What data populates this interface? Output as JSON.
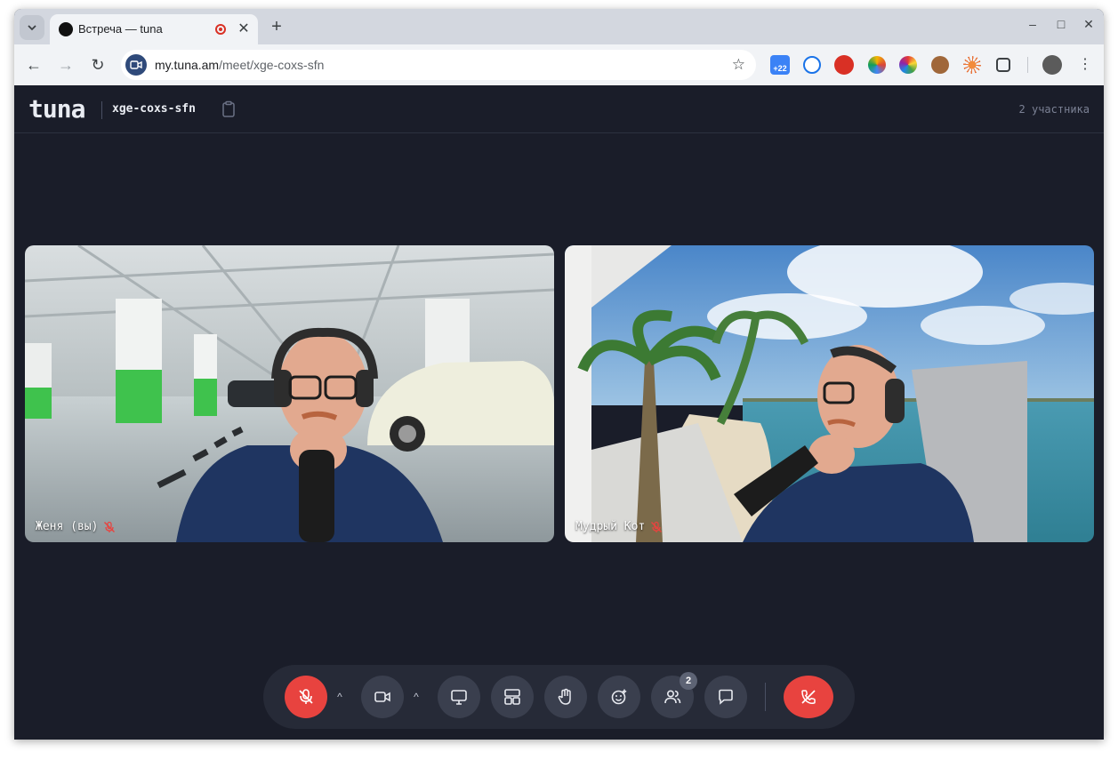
{
  "browser": {
    "tab_title": "Встреча — tuna",
    "url_host": "my.tuna.am",
    "url_path": "/meet/xge-coxs-sfn",
    "extension_badge": "+22"
  },
  "app": {
    "logo": "tuna",
    "meeting_code": "xge-coxs-sfn",
    "participants_count": "2 участника"
  },
  "tiles": [
    {
      "name": "Женя (вы)",
      "muted": true,
      "background": "parking-garage"
    },
    {
      "name": "Мудрый Кот",
      "muted": true,
      "background": "tropical-beach"
    }
  ],
  "controls": {
    "mic": "mic-off",
    "camera": "camera-on",
    "screen_share": "screen-share",
    "layout": "layout",
    "raise_hand": "raise-hand",
    "reactions": "reactions",
    "participants_badge": "2",
    "chat": "chat",
    "leave": "leave-call"
  },
  "colors": {
    "app_background": "#1a1d29",
    "control_bar": "#262a37",
    "button": "#3a3f4e",
    "danger": "#e8433f",
    "mute_indicator": "#e8433f"
  }
}
